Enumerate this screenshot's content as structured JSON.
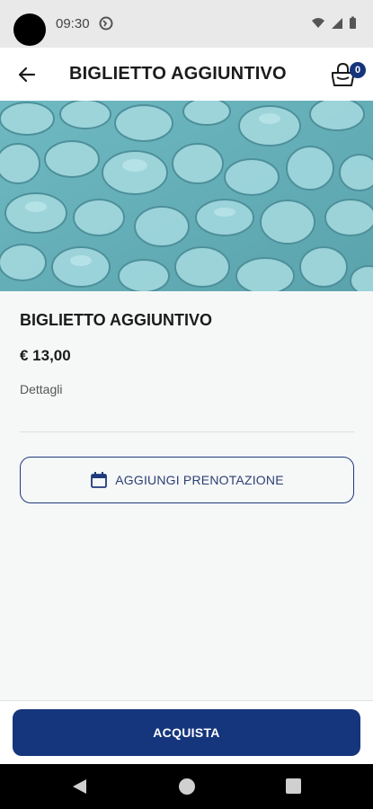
{
  "status_bar": {
    "time": "09:30",
    "icons": [
      "globe-icon",
      "wifi-icon",
      "signal-icon",
      "battery-icon"
    ]
  },
  "app_bar": {
    "title": "BIGLIETTO AGGIUNTIVO",
    "back_icon": "arrow-left-icon",
    "cart_icon": "shopping-bag-icon",
    "cart_count": "0"
  },
  "hero": {
    "description_icon": "pebbles-water-image"
  },
  "product": {
    "title": "BIGLIETTO AGGIUNTIVO",
    "price": "€ 13,00",
    "details_label": "Dettagli"
  },
  "booking_button": {
    "label": "AGGIUNGI PRENOTAZIONE",
    "icon": "calendar-icon"
  },
  "footer": {
    "buy_label": "ACQUISTA"
  },
  "colors": {
    "primary": "#15367d",
    "outline": "#1f3a7a",
    "background": "#f6f8f8",
    "status_bar": "#e9e9e9"
  }
}
